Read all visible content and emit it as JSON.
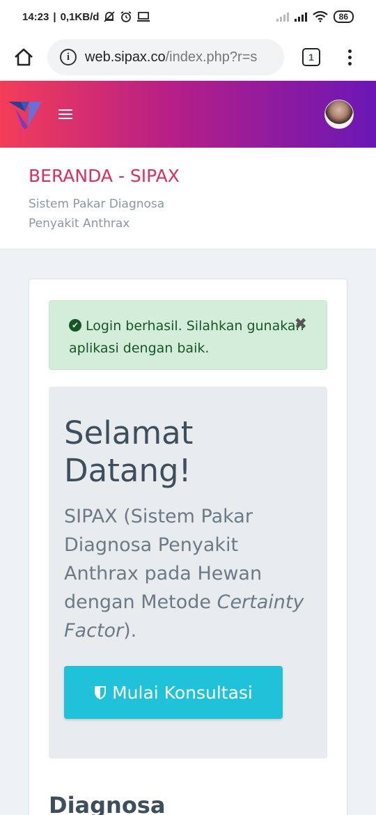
{
  "status_bar": {
    "time": "14:23",
    "network_speed": "0,1KB/d",
    "battery": "86"
  },
  "browser": {
    "url_host": "web.sipax.co",
    "url_path": "/index.php?r=s",
    "tab_count": "1"
  },
  "page": {
    "title": "BERANDA - SIPAX",
    "subtitle": "Sistem Pakar Diagnosa Penyakit Anthrax"
  },
  "alert": {
    "message": "Login berhasil. Silahkan gunakan aplikasi dengan baik.",
    "close_symbol": "✖"
  },
  "jumbotron": {
    "heading": "Selamat Datang!",
    "lead_text": "SIPAX (Sistem Pakar Diagnosa Penyakit Anthrax pada Hewan dengan Metode ",
    "lead_italic": "Certainty Factor",
    "lead_end": ").",
    "button_label": "Mulai Konsultasi"
  },
  "next_section": {
    "heading": "Diagnosa"
  },
  "colors": {
    "header_gradient_start": "#f33d59",
    "header_gradient_end": "#6a17b6",
    "title_color": "#e02d5a",
    "button_color": "#1fc2d9",
    "alert_bg": "#d4edda"
  }
}
